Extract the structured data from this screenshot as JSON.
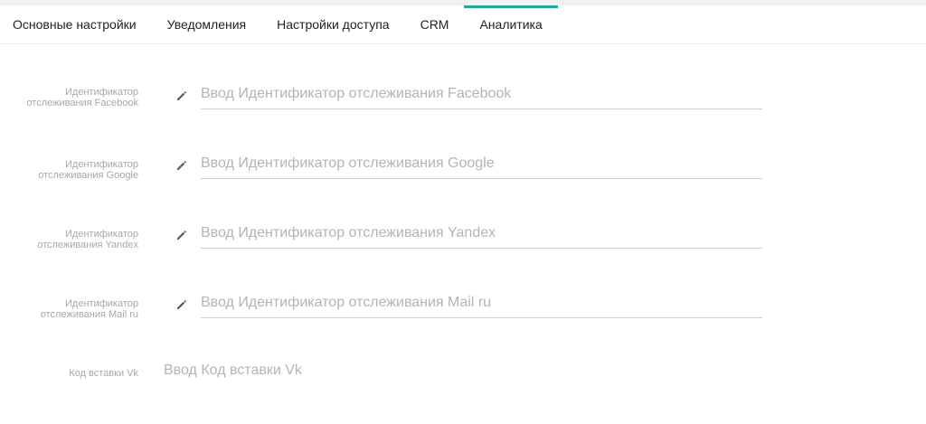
{
  "tabs": [
    {
      "label": "Основные настройки",
      "active": false
    },
    {
      "label": "Уведомления",
      "active": false
    },
    {
      "label": "Настройки доступа",
      "active": false
    },
    {
      "label": "CRM",
      "active": false
    },
    {
      "label": "Аналитика",
      "active": true
    }
  ],
  "colors": {
    "accent": "#26a69a",
    "label": "#a8a8a8",
    "placeholder": "#b4b4b4",
    "underline": "#cfcfcf"
  },
  "fields": [
    {
      "label_line1": "Идентификатор",
      "label_line2": "отслеживания Facebook",
      "icon": "pencil-icon",
      "value": "",
      "placeholder": "Ввод Идентификатор отслеживания Facebook"
    },
    {
      "label_line1": "Идентификатор",
      "label_line2": "отслеживания Google",
      "icon": "pencil-icon",
      "value": "",
      "placeholder": "Ввод Идентификатор отслеживания Google"
    },
    {
      "label_line1": "Идентификатор",
      "label_line2": "отслеживания Yandex",
      "icon": "pencil-icon",
      "value": "",
      "placeholder": "Ввод Идентификатор отслеживания Yandex"
    },
    {
      "label_line1": "Идентификатор",
      "label_line2": "отслеживания Mail ru",
      "icon": "pencil-icon",
      "value": "",
      "placeholder": "Ввод Идентификатор отслеживания Mail ru"
    }
  ],
  "vk_field": {
    "label": "Код вставки Vk",
    "value": "",
    "placeholder": "Ввод Код вставки Vk"
  }
}
